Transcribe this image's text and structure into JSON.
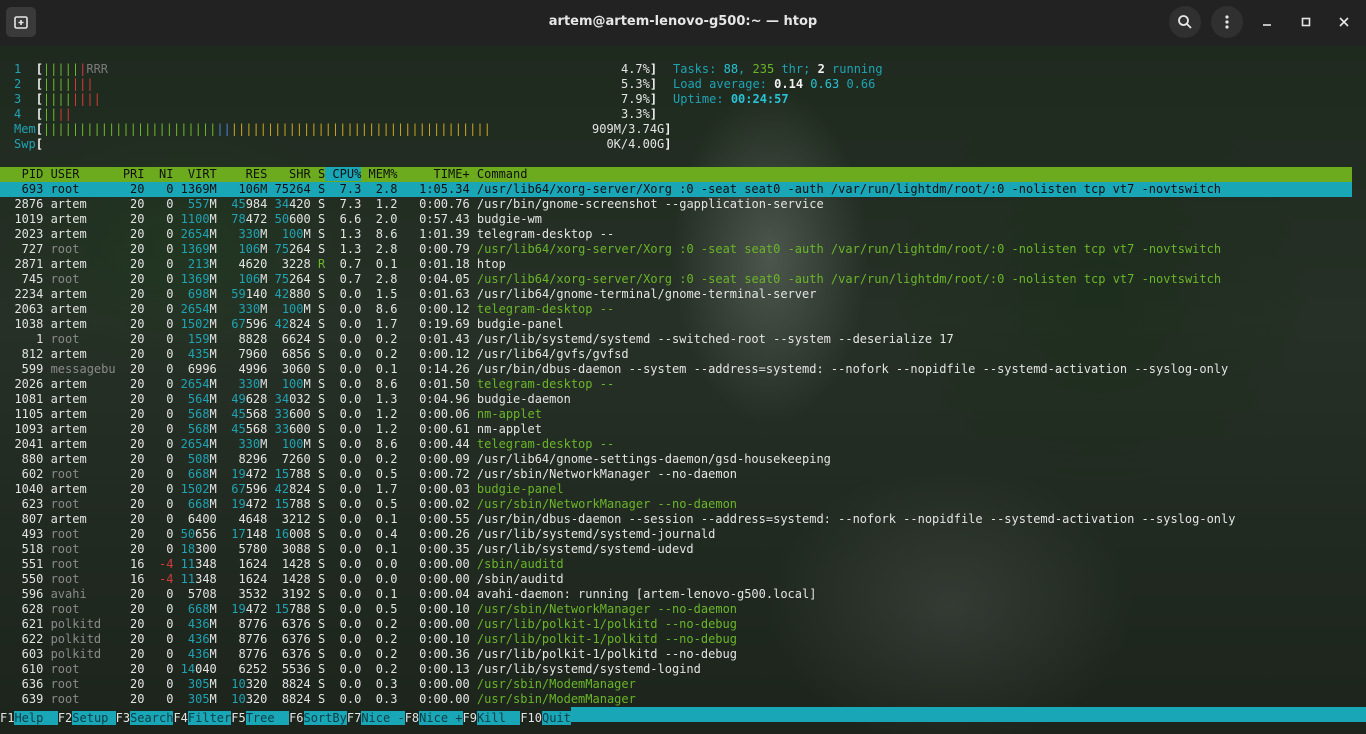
{
  "window": {
    "title": "artem@artem-lenovo-g500:~ — htop",
    "new_tab_icon": "new-tab-icon",
    "search_icon": "search-icon",
    "menu_icon": "kebab-menu-icon"
  },
  "meters": {
    "cpu": [
      {
        "label": "1",
        "bar": "||||||RRR",
        "pct": "4.7%"
      },
      {
        "label": "2",
        "bar": "|||||||",
        "pct": "5.3%"
      },
      {
        "label": "3",
        "bar": "||||||||",
        "pct": "7.9%"
      },
      {
        "label": "4",
        "bar": "||||",
        "pct": "3.3%"
      }
    ],
    "mem": {
      "label": "Mem",
      "bar": "||||||||||||||||||||||||||||||||||||||||||||||||||||||||||||||||||||||||||||||||||||||||||||||||||||||||||",
      "value": "909M/3.74G"
    },
    "swp": {
      "label": "Swp",
      "bar": "",
      "value": "0K/4.00G"
    }
  },
  "summary": {
    "tasks_label": "Tasks:",
    "tasks": "88",
    "thr": "235",
    "thr_label": "thr;",
    "running": "2",
    "running_label": "running",
    "load_label": "Load average:",
    "load1": "0.14",
    "load5": "0.63",
    "load15": "0.66",
    "uptime_label": "Uptime:",
    "uptime": "00:24:57"
  },
  "table": {
    "columns": [
      "PID",
      "USER",
      "PRI",
      "NI",
      "VIRT",
      "RES",
      "SHR",
      "S",
      "CPU%",
      "MEM%",
      "TIME+",
      "Command"
    ],
    "rows": [
      {
        "pid": "693",
        "user": "root",
        "pri": "20",
        "ni": "0",
        "virt": "1369M",
        "res": "106M",
        "shr": "75264",
        "s": "S",
        "cpu": "7.3",
        "mem": "2.8",
        "time": "1:05.34",
        "cmd": "/usr/lib64/xorg-server/Xorg :0 -seat seat0 -auth /var/run/lightdm/root/:0 -nolisten tcp vt7 -novtswitch",
        "selected": true
      },
      {
        "pid": "2876",
        "user": "artem",
        "pri": "20",
        "ni": "0",
        "virt": "557M",
        "res": "45984",
        "shr": "34420",
        "s": "S",
        "cpu": "7.3",
        "mem": "1.2",
        "time": "0:00.76",
        "cmd": "/usr/bin/gnome-screenshot --gapplication-service"
      },
      {
        "pid": "1019",
        "user": "artem",
        "pri": "20",
        "ni": "0",
        "virt": "1100M",
        "res": "78472",
        "shr": "50600",
        "s": "S",
        "cpu": "6.6",
        "mem": "2.0",
        "time": "0:57.43",
        "cmd": "budgie-wm"
      },
      {
        "pid": "2023",
        "user": "artem",
        "pri": "20",
        "ni": "0",
        "virt": "2654M",
        "res": "330M",
        "shr": "100M",
        "s": "S",
        "cpu": "1.3",
        "mem": "8.6",
        "time": "1:01.39",
        "cmd": "telegram-desktop --"
      },
      {
        "pid": "727",
        "user": "root",
        "pri": "20",
        "ni": "0",
        "virt": "1369M",
        "res": "106M",
        "shr": "75264",
        "s": "S",
        "cpu": "1.3",
        "mem": "2.8",
        "time": "0:00.79",
        "cmd": "/usr/lib64/xorg-server/Xorg :0 -seat seat0 -auth /var/run/lightdm/root/:0 -nolisten tcp vt7 -novtswitch",
        "thread": true
      },
      {
        "pid": "2871",
        "user": "artem",
        "pri": "20",
        "ni": "0",
        "virt": "213M",
        "res": "4620",
        "shr": "3228",
        "s": "R",
        "cpu": "0.7",
        "mem": "0.1",
        "time": "0:01.18",
        "cmd": "htop"
      },
      {
        "pid": "745",
        "user": "root",
        "pri": "20",
        "ni": "0",
        "virt": "1369M",
        "res": "106M",
        "shr": "75264",
        "s": "S",
        "cpu": "0.7",
        "mem": "2.8",
        "time": "0:04.05",
        "cmd": "/usr/lib64/xorg-server/Xorg :0 -seat seat0 -auth /var/run/lightdm/root/:0 -nolisten tcp vt7 -novtswitch",
        "thread": true
      },
      {
        "pid": "2234",
        "user": "artem",
        "pri": "20",
        "ni": "0",
        "virt": "698M",
        "res": "59140",
        "shr": "42880",
        "s": "S",
        "cpu": "0.0",
        "mem": "1.5",
        "time": "0:01.63",
        "cmd": "/usr/lib64/gnome-terminal/gnome-terminal-server"
      },
      {
        "pid": "2063",
        "user": "artem",
        "pri": "20",
        "ni": "0",
        "virt": "2654M",
        "res": "330M",
        "shr": "100M",
        "s": "S",
        "cpu": "0.0",
        "mem": "8.6",
        "time": "0:00.12",
        "cmd": "telegram-desktop --",
        "thread": true
      },
      {
        "pid": "1038",
        "user": "artem",
        "pri": "20",
        "ni": "0",
        "virt": "1502M",
        "res": "67596",
        "shr": "42824",
        "s": "S",
        "cpu": "0.0",
        "mem": "1.7",
        "time": "0:19.69",
        "cmd": "budgie-panel"
      },
      {
        "pid": "1",
        "user": "root",
        "pri": "20",
        "ni": "0",
        "virt": "159M",
        "res": "8828",
        "shr": "6624",
        "s": "S",
        "cpu": "0.0",
        "mem": "0.2",
        "time": "0:01.43",
        "cmd": "/usr/lib/systemd/systemd --switched-root --system --deserialize 17"
      },
      {
        "pid": "812",
        "user": "artem",
        "pri": "20",
        "ni": "0",
        "virt": "435M",
        "res": "7960",
        "shr": "6856",
        "s": "S",
        "cpu": "0.0",
        "mem": "0.2",
        "time": "0:00.12",
        "cmd": "/usr/lib64/gvfs/gvfsd"
      },
      {
        "pid": "599",
        "user": "messagebu",
        "pri": "20",
        "ni": "0",
        "virt": "6996",
        "res": "4996",
        "shr": "3060",
        "s": "S",
        "cpu": "0.0",
        "mem": "0.1",
        "time": "0:14.26",
        "cmd": "/usr/bin/dbus-daemon --system --address=systemd: --nofork --nopidfile --systemd-activation --syslog-only"
      },
      {
        "pid": "2026",
        "user": "artem",
        "pri": "20",
        "ni": "0",
        "virt": "2654M",
        "res": "330M",
        "shr": "100M",
        "s": "S",
        "cpu": "0.0",
        "mem": "8.6",
        "time": "0:01.50",
        "cmd": "telegram-desktop --",
        "thread": true
      },
      {
        "pid": "1081",
        "user": "artem",
        "pri": "20",
        "ni": "0",
        "virt": "564M",
        "res": "49628",
        "shr": "34032",
        "s": "S",
        "cpu": "0.0",
        "mem": "1.3",
        "time": "0:04.96",
        "cmd": "budgie-daemon"
      },
      {
        "pid": "1105",
        "user": "artem",
        "pri": "20",
        "ni": "0",
        "virt": "568M",
        "res": "45568",
        "shr": "33600",
        "s": "S",
        "cpu": "0.0",
        "mem": "1.2",
        "time": "0:00.06",
        "cmd": "nm-applet",
        "thread": true
      },
      {
        "pid": "1093",
        "user": "artem",
        "pri": "20",
        "ni": "0",
        "virt": "568M",
        "res": "45568",
        "shr": "33600",
        "s": "S",
        "cpu": "0.0",
        "mem": "1.2",
        "time": "0:00.61",
        "cmd": "nm-applet"
      },
      {
        "pid": "2041",
        "user": "artem",
        "pri": "20",
        "ni": "0",
        "virt": "2654M",
        "res": "330M",
        "shr": "100M",
        "s": "S",
        "cpu": "0.0",
        "mem": "8.6",
        "time": "0:00.44",
        "cmd": "telegram-desktop --",
        "thread": true
      },
      {
        "pid": "880",
        "user": "artem",
        "pri": "20",
        "ni": "0",
        "virt": "508M",
        "res": "8296",
        "shr": "7260",
        "s": "S",
        "cpu": "0.0",
        "mem": "0.2",
        "time": "0:00.09",
        "cmd": "/usr/lib64/gnome-settings-daemon/gsd-housekeeping"
      },
      {
        "pid": "602",
        "user": "root",
        "pri": "20",
        "ni": "0",
        "virt": "668M",
        "res": "19472",
        "shr": "15788",
        "s": "S",
        "cpu": "0.0",
        "mem": "0.5",
        "time": "0:00.72",
        "cmd": "/usr/sbin/NetworkManager --no-daemon"
      },
      {
        "pid": "1040",
        "user": "artem",
        "pri": "20",
        "ni": "0",
        "virt": "1502M",
        "res": "67596",
        "shr": "42824",
        "s": "S",
        "cpu": "0.0",
        "mem": "1.7",
        "time": "0:00.03",
        "cmd": "budgie-panel",
        "thread": true
      },
      {
        "pid": "623",
        "user": "root",
        "pri": "20",
        "ni": "0",
        "virt": "668M",
        "res": "19472",
        "shr": "15788",
        "s": "S",
        "cpu": "0.0",
        "mem": "0.5",
        "time": "0:00.02",
        "cmd": "/usr/sbin/NetworkManager --no-daemon",
        "thread": true
      },
      {
        "pid": "807",
        "user": "artem",
        "pri": "20",
        "ni": "0",
        "virt": "6400",
        "res": "4648",
        "shr": "3212",
        "s": "S",
        "cpu": "0.0",
        "mem": "0.1",
        "time": "0:00.55",
        "cmd": "/usr/bin/dbus-daemon --session --address=systemd: --nofork --nopidfile --systemd-activation --syslog-only"
      },
      {
        "pid": "493",
        "user": "root",
        "pri": "20",
        "ni": "0",
        "virt": "50656",
        "res": "17148",
        "shr": "16008",
        "s": "S",
        "cpu": "0.0",
        "mem": "0.4",
        "time": "0:00.26",
        "cmd": "/usr/lib/systemd/systemd-journald"
      },
      {
        "pid": "518",
        "user": "root",
        "pri": "20",
        "ni": "0",
        "virt": "18300",
        "res": "5780",
        "shr": "3088",
        "s": "S",
        "cpu": "0.0",
        "mem": "0.1",
        "time": "0:00.35",
        "cmd": "/usr/lib/systemd/systemd-udevd"
      },
      {
        "pid": "551",
        "user": "root",
        "pri": "16",
        "ni": "-4",
        "virt": "11348",
        "res": "1624",
        "shr": "1428",
        "s": "S",
        "cpu": "0.0",
        "mem": "0.0",
        "time": "0:00.00",
        "cmd": "/sbin/auditd",
        "thread": true
      },
      {
        "pid": "550",
        "user": "root",
        "pri": "16",
        "ni": "-4",
        "virt": "11348",
        "res": "1624",
        "shr": "1428",
        "s": "S",
        "cpu": "0.0",
        "mem": "0.0",
        "time": "0:00.00",
        "cmd": "/sbin/auditd"
      },
      {
        "pid": "596",
        "user": "avahi",
        "pri": "20",
        "ni": "0",
        "virt": "5708",
        "res": "3532",
        "shr": "3192",
        "s": "S",
        "cpu": "0.0",
        "mem": "0.1",
        "time": "0:00.04",
        "cmd": "avahi-daemon: running [artem-lenovo-g500.local]"
      },
      {
        "pid": "628",
        "user": "root",
        "pri": "20",
        "ni": "0",
        "virt": "668M",
        "res": "19472",
        "shr": "15788",
        "s": "S",
        "cpu": "0.0",
        "mem": "0.5",
        "time": "0:00.10",
        "cmd": "/usr/sbin/NetworkManager --no-daemon",
        "thread": true
      },
      {
        "pid": "621",
        "user": "polkitd",
        "pri": "20",
        "ni": "0",
        "virt": "436M",
        "res": "8776",
        "shr": "6376",
        "s": "S",
        "cpu": "0.0",
        "mem": "0.2",
        "time": "0:00.00",
        "cmd": "/usr/lib/polkit-1/polkitd --no-debug",
        "thread": true
      },
      {
        "pid": "622",
        "user": "polkitd",
        "pri": "20",
        "ni": "0",
        "virt": "436M",
        "res": "8776",
        "shr": "6376",
        "s": "S",
        "cpu": "0.0",
        "mem": "0.2",
        "time": "0:00.10",
        "cmd": "/usr/lib/polkit-1/polkitd --no-debug",
        "thread": true
      },
      {
        "pid": "603",
        "user": "polkitd",
        "pri": "20",
        "ni": "0",
        "virt": "436M",
        "res": "8776",
        "shr": "6376",
        "s": "S",
        "cpu": "0.0",
        "mem": "0.2",
        "time": "0:00.36",
        "cmd": "/usr/lib/polkit-1/polkitd --no-debug"
      },
      {
        "pid": "610",
        "user": "root",
        "pri": "20",
        "ni": "0",
        "virt": "14040",
        "res": "6252",
        "shr": "5536",
        "s": "S",
        "cpu": "0.0",
        "mem": "0.2",
        "time": "0:00.13",
        "cmd": "/usr/lib/systemd/systemd-logind"
      },
      {
        "pid": "636",
        "user": "root",
        "pri": "20",
        "ni": "0",
        "virt": "305M",
        "res": "10320",
        "shr": "8824",
        "s": "S",
        "cpu": "0.0",
        "mem": "0.3",
        "time": "0:00.00",
        "cmd": "/usr/sbin/ModemManager",
        "thread": true
      },
      {
        "pid": "639",
        "user": "root",
        "pri": "20",
        "ni": "0",
        "virt": "305M",
        "res": "10320",
        "shr": "8824",
        "s": "S",
        "cpu": "0.0",
        "mem": "0.3",
        "time": "0:00.00",
        "cmd": "/usr/sbin/ModemManager",
        "thread": true
      }
    ]
  },
  "fkeys": [
    {
      "key": "F1",
      "label": "Help  "
    },
    {
      "key": "F2",
      "label": "Setup "
    },
    {
      "key": "F3",
      "label": "Search"
    },
    {
      "key": "F4",
      "label": "Filter"
    },
    {
      "key": "F5",
      "label": "Tree  "
    },
    {
      "key": "F6",
      "label": "SortBy"
    },
    {
      "key": "F7",
      "label": "Nice -"
    },
    {
      "key": "F8",
      "label": "Nice +"
    },
    {
      "key": "F9",
      "label": "Kill  "
    },
    {
      "key": "F10",
      "label": "Quit"
    }
  ],
  "colors": {
    "header_bg": "#6dab1e",
    "selected_bg": "#19a7b8",
    "thread_fg": "#6ab52a",
    "titlebar_bg": "#222222"
  }
}
